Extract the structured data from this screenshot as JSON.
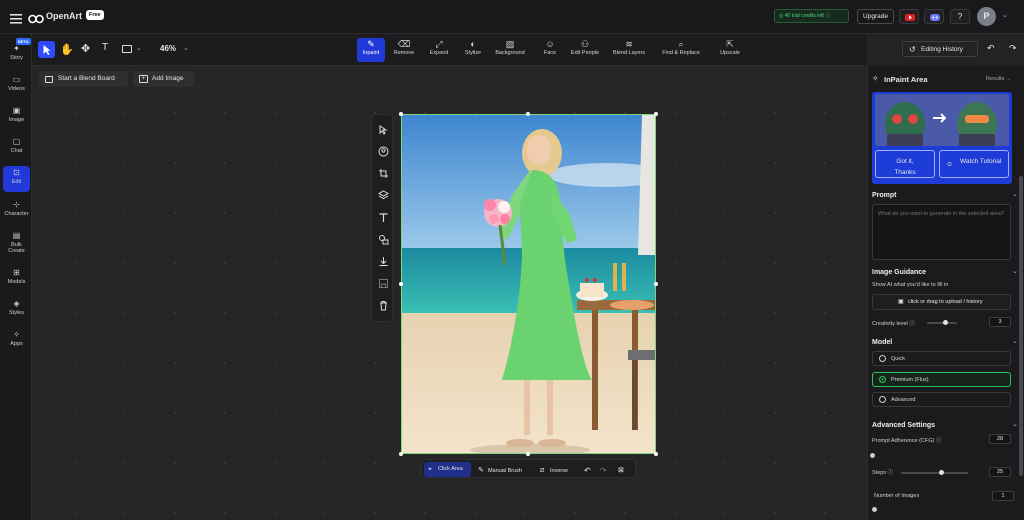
{
  "app": {
    "name": "OpenArt",
    "badge": "Free"
  },
  "topbar": {
    "credits": "40 trial credits left",
    "upgrade": "Upgrade",
    "avatar": "P"
  },
  "sidebar": {
    "beta": "BETA",
    "items": [
      {
        "label": "Story",
        "icon": "story-icon"
      },
      {
        "label": "Videos",
        "icon": "video-icon"
      },
      {
        "label": "Image",
        "icon": "image-icon"
      },
      {
        "label": "Chat",
        "icon": "chat-icon"
      },
      {
        "label": "Edit",
        "icon": "edit-icon"
      },
      {
        "label": "Character",
        "icon": "character-icon"
      },
      {
        "label": "Bulk Create",
        "icon": "bulk-icon"
      },
      {
        "label": "Models",
        "icon": "models-icon"
      },
      {
        "label": "Styles",
        "icon": "styles-icon"
      },
      {
        "label": "Apps",
        "icon": "apps-icon"
      }
    ]
  },
  "toolbar": {
    "zoom": "46%",
    "history": "Editing History",
    "tools": [
      {
        "label": "Inpaint",
        "icon": "inpaint-icon",
        "active": true
      },
      {
        "label": "Remove",
        "icon": "eraser-icon"
      },
      {
        "label": "Expand",
        "icon": "expand-icon"
      },
      {
        "label": "Stylize",
        "icon": "palette-icon"
      },
      {
        "label": "Background",
        "icon": "background-icon"
      },
      {
        "label": "Face",
        "icon": "face-icon"
      },
      {
        "label": "Edit People",
        "icon": "people-icon"
      },
      {
        "label": "Blend Layers",
        "icon": "layers-icon"
      },
      {
        "label": "Find & Replace",
        "icon": "search-icon"
      },
      {
        "label": "Upscale",
        "icon": "upscale-icon"
      }
    ]
  },
  "canvas": {
    "blend_board": "Start a Blend Board",
    "add_image": "Add Image",
    "bottom_tools": {
      "click_area": "Click Area",
      "manual_brush": "Manual Brush",
      "inverse": "Inverse"
    }
  },
  "panel": {
    "title": "InPaint Area",
    "results": "Results",
    "promo": {
      "got_it": "Got it, Thanks",
      "watch": "Watch Tutorial"
    },
    "prompt": {
      "heading": "Prompt",
      "placeholder": "What do you want to generate in the selected area?"
    },
    "guidance": {
      "heading": "Image Guidance",
      "desc": "Show AI what you'd like to fill in",
      "upload": "click or drag to upload / history",
      "creativity_label": "Creativity level",
      "creativity": "3",
      "creativity_level": 0.6
    },
    "model": {
      "heading": "Model",
      "options": [
        {
          "label": "Quick",
          "selected": false
        },
        {
          "label": "Premium (Flux)",
          "selected": true
        },
        {
          "label": "Advanced",
          "selected": false
        }
      ]
    },
    "advanced": {
      "heading": "Advanced Settings",
      "cfg_label": "Prompt Adherence (CFG)",
      "cfg": "28",
      "steps_label": "Steps",
      "steps": "25",
      "steps_level": 0.6,
      "num_label": "Number of Images",
      "num": "1"
    }
  },
  "colors": {
    "accent": "#2f6bff",
    "active": "#1f40d8",
    "credits": "#2ecc71",
    "mask": "#7fd67f",
    "selected_model": "#2fbf5a"
  }
}
